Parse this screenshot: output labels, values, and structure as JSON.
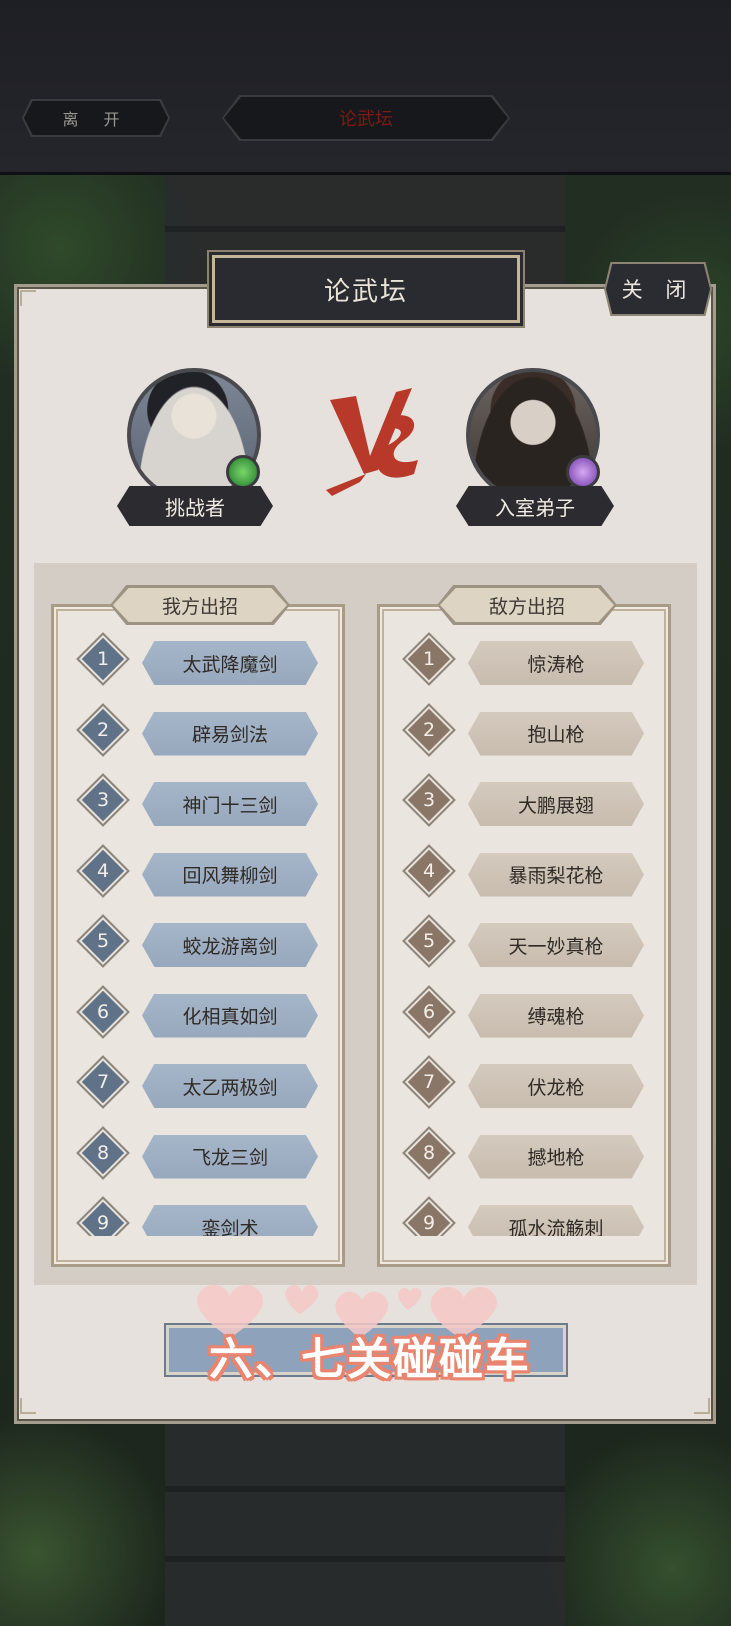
{
  "top_bar": {
    "leave_label": "离 开",
    "title": "论武坛"
  },
  "panel": {
    "title": "论武坛",
    "close_label": "关 闭"
  },
  "challenger": {
    "name": "挑战者"
  },
  "opponent": {
    "name": "入室弟子"
  },
  "left_column": {
    "header": "我方出招",
    "moves": [
      {
        "num": "1",
        "name": "太武降魔剑"
      },
      {
        "num": "2",
        "name": "辟易剑法"
      },
      {
        "num": "3",
        "name": "神门十三剑"
      },
      {
        "num": "4",
        "name": "回风舞柳剑"
      },
      {
        "num": "5",
        "name": "蛟龙游离剑"
      },
      {
        "num": "6",
        "name": "化相真如剑"
      },
      {
        "num": "7",
        "name": "太乙两极剑"
      },
      {
        "num": "8",
        "name": "飞龙三剑"
      },
      {
        "num": "9",
        "name": "銮剑术"
      }
    ]
  },
  "right_column": {
    "header": "敌方出招",
    "moves": [
      {
        "num": "1",
        "name": "惊涛枪"
      },
      {
        "num": "2",
        "name": "抱山枪"
      },
      {
        "num": "3",
        "name": "大鹏展翅"
      },
      {
        "num": "4",
        "name": "暴雨梨花枪"
      },
      {
        "num": "5",
        "name": "天一妙真枪"
      },
      {
        "num": "6",
        "name": "缚魂枪"
      },
      {
        "num": "7",
        "name": "伏龙枪"
      },
      {
        "num": "8",
        "name": "撼地枪"
      },
      {
        "num": "9",
        "name": "孤水流觞刺"
      }
    ]
  },
  "overlay_caption": "六、七关碰碰车",
  "colors": {
    "accent_red": "#b8392a",
    "left_skill": "#9fb0c4",
    "right_skill": "#cdc3b6",
    "caption_outline": "#e9846f"
  }
}
